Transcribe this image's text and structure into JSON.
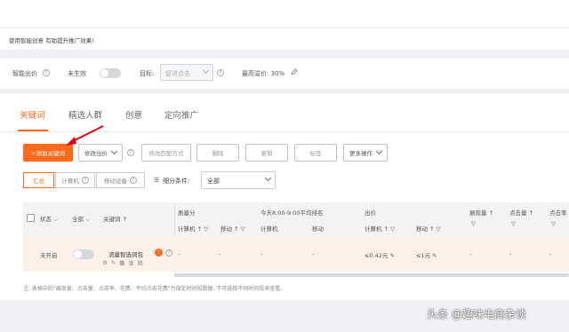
{
  "banner": {
    "text": "使用智能创意 有助提升推广效果!"
  },
  "settings": {
    "smart_bid_label": "智能出价",
    "status_text": "未生效",
    "goal_label": "目标:",
    "goal_value": "促进点击",
    "premium_label": "最高溢价: 30%"
  },
  "tabs": [
    {
      "label": "关键词",
      "active": true
    },
    {
      "label": "精选人群",
      "active": false
    },
    {
      "label": "创意",
      "active": false
    },
    {
      "label": "定向推广",
      "active": false
    }
  ],
  "toolbar": {
    "add_keyword": "+添加关键词",
    "modify_bid": "修改出价",
    "modify_match": "修改匹配方式",
    "delete": "删除",
    "copy": "复制",
    "tag": "标签",
    "more_ops": "更多操作"
  },
  "device_filter": {
    "options": [
      "汇总",
      "计算机",
      "移动设备"
    ],
    "selected": "汇总",
    "breakdown_label": "细分条件:",
    "breakdown_value": "全部"
  },
  "table": {
    "headers": {
      "status": "状态",
      "all": "全部",
      "keyword": "关键词",
      "quality_score": "质量分",
      "today_rank": "今天8:00-9:00平均排名",
      "bid": "出价",
      "impressions": "展现量",
      "clicks": "点击量",
      "click_rate": "点击率"
    },
    "subheaders": {
      "qs_pc": "计算机",
      "qs_mobile": "移动",
      "rank_pc": "计算机",
      "rank_mobile": "移动",
      "bid_pc": "计算机",
      "bid_mobile": "移动"
    },
    "row": {
      "status": "未开启",
      "keyword": "流量智选词包",
      "qs_pc": "-",
      "qs_mobile": "-",
      "rank_pc": "-",
      "rank_mobile": "-",
      "bid_pc": "≤0.42元",
      "bid_mobile": "≤1元",
      "impressions": "-",
      "clicks": "-",
      "click_rate": "-"
    }
  },
  "footnote": "注: 表格中的\"展现量、点击量、点击率、花费、平均点击花费\"为指定时间段数据, 不可选择不同时间段来查看。",
  "watermark": "头条 @趣味电商杂谈",
  "colors": {
    "accent": "#ff6a1a",
    "row_highlight": "#fdf2ea"
  }
}
